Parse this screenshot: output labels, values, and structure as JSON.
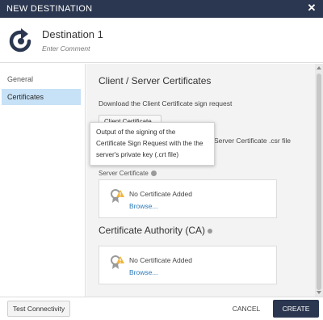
{
  "dialog": {
    "title": "NEW DESTINATION",
    "close_icon": "close-icon"
  },
  "header": {
    "name": "Destination 1",
    "comment_placeholder": "Enter Comment",
    "logo_icon": "destination-logo-icon"
  },
  "sidebar": {
    "items": [
      {
        "label": "General",
        "active": false
      },
      {
        "label": "Certificates",
        "active": true
      }
    ]
  },
  "content": {
    "section_title": "Client / Server Certificates",
    "download_text": "Download the Client Certificate sign request",
    "client_cert_button": "Client Certificate",
    "obscured_text": "Server Certificate .csr file",
    "server_cert_label": "Server Certificate",
    "server_cert": {
      "status": "No Certificate Added",
      "browse": "Browse..."
    },
    "ca_title": "Certificate Authority (CA)",
    "ca_cert": {
      "status": "No Certificate Added",
      "browse": "Browse..."
    }
  },
  "tooltip": {
    "lines": [
      "Output of the signing of the",
      "Certificate Sign Request with the the",
      "server's private key (.crt file)"
    ]
  },
  "footer": {
    "test_button": "Test Connectivity",
    "cancel_button": "CANCEL",
    "create_button": "CREATE"
  },
  "colors": {
    "titlebar": "#2b3750",
    "active_item": "#c7e1f6",
    "link": "#2e7ab8",
    "warning": "#f1b43a"
  }
}
